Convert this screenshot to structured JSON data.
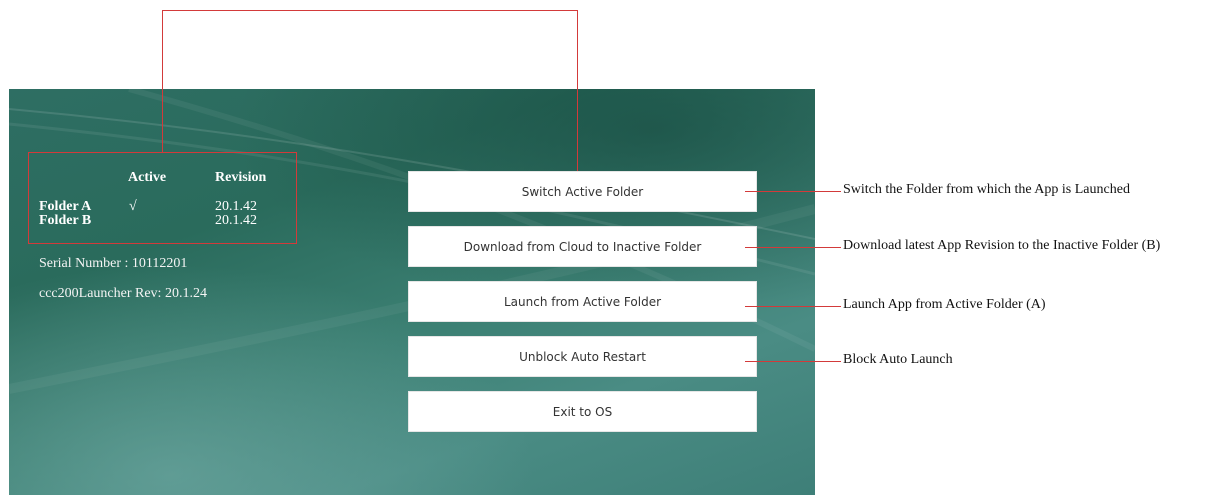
{
  "folders_table": {
    "headers": {
      "active": "Active",
      "revision": "Revision"
    },
    "rows": [
      {
        "folder": "Folder A",
        "active": "√",
        "revision": "20.1.42"
      },
      {
        "folder": "Folder B",
        "active": "",
        "revision": "20.1.42"
      }
    ]
  },
  "device": {
    "serial_number": "Serial Number : 10112201",
    "launcher_revision": "ccc200Launcher Rev: 20.1.24"
  },
  "buttons": {
    "switch_active_folder": "Switch Active Folder",
    "download_from_cloud": "Download from Cloud to Inactive Folder",
    "launch_from_active": "Launch from Active Folder",
    "unblock_auto_restart": "Unblock Auto Restart",
    "exit_to_os": "Exit to OS"
  },
  "annotations": {
    "switch": "Switch the Folder from which the App is Launched",
    "download": "Download latest App Revision to the Inactive Folder (B)",
    "launch": "Launch App from Active Folder (A)",
    "block": "Block Auto Launch"
  },
  "colors": {
    "annotation_red": "#d33a3a",
    "background_green": "#2e6e63",
    "button_bg": "#ffffff"
  }
}
